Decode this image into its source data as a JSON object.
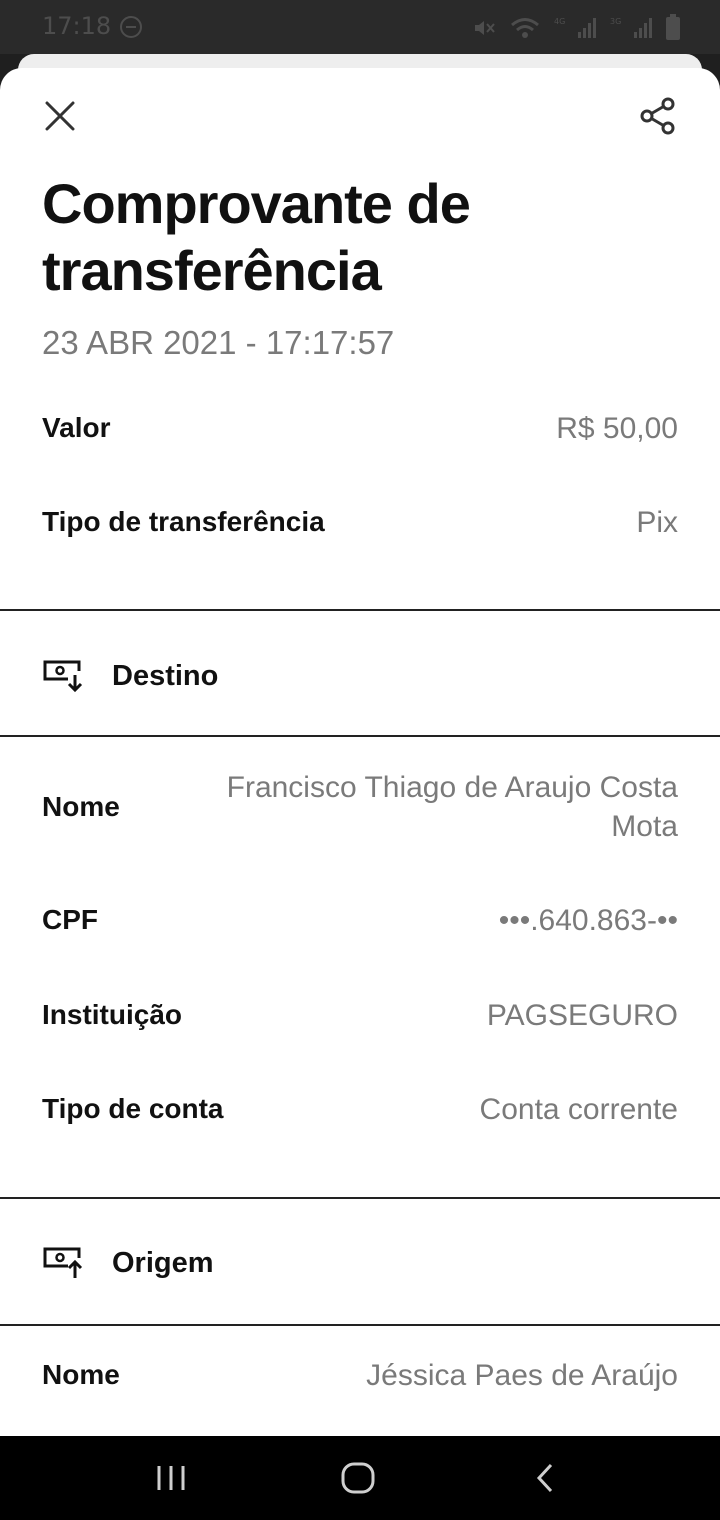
{
  "status_bar": {
    "time": "17:18",
    "icons": [
      "dnd-icon",
      "mute-icon",
      "wifi-icon",
      "signal-4g-icon",
      "signal-3g-icon",
      "battery-icon"
    ]
  },
  "header": {
    "close_icon": "close-icon",
    "share_icon": "share-icon"
  },
  "receipt": {
    "title": "Comprovante de transferência",
    "datetime": "23 ABR 2021 - 17:17:57",
    "summary": [
      {
        "label": "Valor",
        "value": "R$ 50,00"
      },
      {
        "label": "Tipo de transferência",
        "value": "Pix"
      }
    ],
    "destination": {
      "section_title": "Destino",
      "icon": "destination-account-icon",
      "fields": [
        {
          "label": "Nome",
          "value": "Francisco Thiago de Araujo Costa Mota"
        },
        {
          "label": "CPF",
          "value": "•••.640.863-••"
        },
        {
          "label": "Instituição",
          "value": "PAGSEGURO"
        },
        {
          "label": "Tipo de conta",
          "value": "Conta corrente"
        }
      ]
    },
    "origin": {
      "section_title": "Origem",
      "icon": "origin-account-icon",
      "fields": [
        {
          "label": "Nome",
          "value": "Jéssica Paes de Araújo"
        }
      ]
    }
  },
  "nav_bar": {
    "buttons": [
      "recents-icon",
      "home-icon",
      "back-icon"
    ]
  }
}
